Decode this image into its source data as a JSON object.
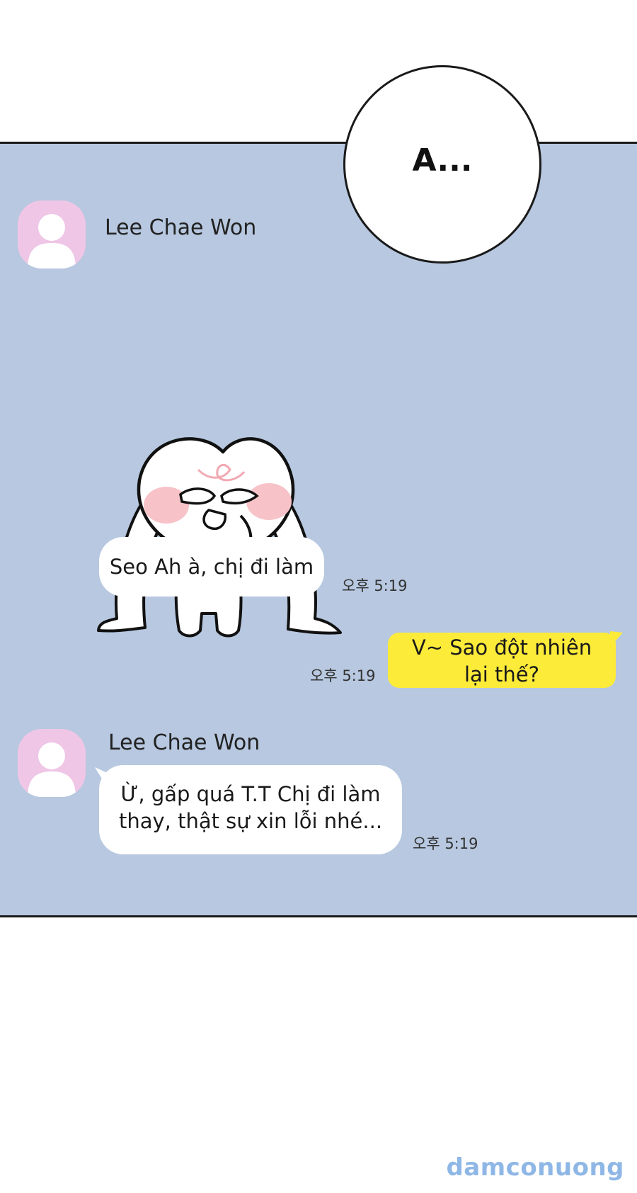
{
  "speech_bubble": {
    "text": "A..."
  },
  "messages": [
    {
      "sender": "Lee Chae Won"
    },
    {
      "text": "Seo Ah à, chị đi làm",
      "time": "오후 5:19"
    },
    {
      "line1": "V~ Sao đột nhiên",
      "line2": "lại thế?",
      "time": "오후 5:19"
    },
    {
      "sender": "Lee Chae Won",
      "line1": "Ừ, gấp quá T.T Chị đi làm",
      "line2": "thay, thật sự xin lỗi nhé...",
      "time": "오후 5:19"
    }
  ],
  "watermark": "damconuong",
  "colors": {
    "chat_bg": "#b7c8e0",
    "own_bubble": "#fdeb3a",
    "avatar_bg": "#efc6e6"
  },
  "icons": [
    "default-avatar-icon",
    "crying-rabbit-sticker"
  ]
}
